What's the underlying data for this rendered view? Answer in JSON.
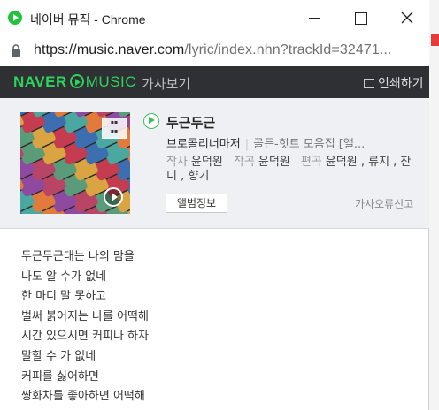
{
  "window": {
    "app_title": "네이버 뮤직 - Chrome",
    "url_host": "https://music.naver.com",
    "url_path": "/lyric/index.nhn?trackId=32471..."
  },
  "header": {
    "brand_naver": "NAVER",
    "brand_music": "MUSIC",
    "subtitle": "가사보기",
    "print_label": "인쇄하기"
  },
  "track": {
    "title": "두근두근",
    "artist": "브로콜리너마저",
    "album": "골든-힛트 모음집 [앨...",
    "credits": {
      "lyricist_label": "작사",
      "lyricist": "윤덕원",
      "composer_label": "작곡",
      "composer": "윤덕원",
      "arranger_label": "편곡",
      "arranger": "윤덕원 , 류지 , 잔디 , 향기"
    },
    "album_button": "앨범정보",
    "report_link": "가사오류신고"
  },
  "lyrics": [
    "두근두근대는 나의 맘을",
    "나도 알 수가 없네",
    "한 마디 말 못하고",
    "벌써 붉어지는 나를 어떡해",
    "시간 있으시면 커피나 하자",
    "말할 수 가 없네",
    "커피를 싫어하면",
    "쌍화차를 좋아하면 어떡해"
  ],
  "colors": {
    "naver_green": "#2dd35b",
    "header_bg": "#2e3033",
    "info_bg": "#eef0f3"
  }
}
